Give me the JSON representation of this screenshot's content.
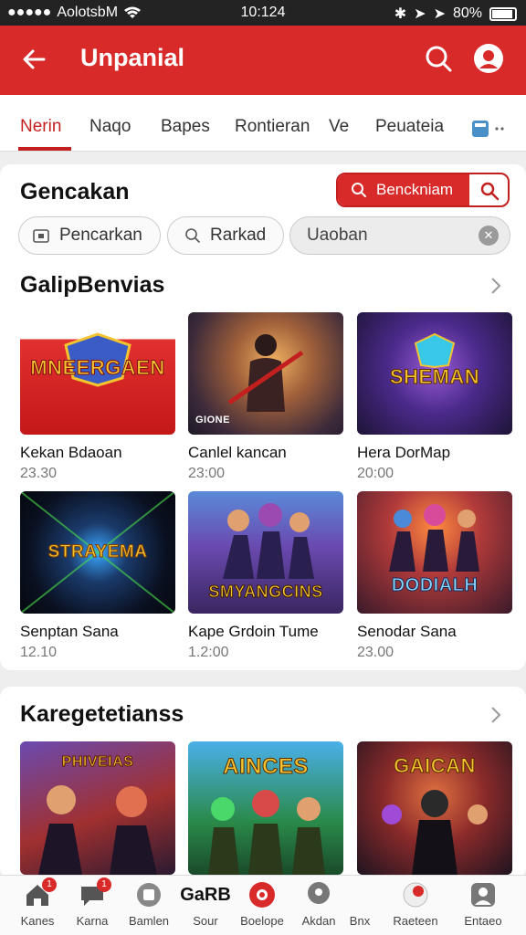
{
  "status_bar": {
    "carrier": "AolotsbM",
    "time": "10:124",
    "battery": "80%"
  },
  "app_bar": {
    "title": "Unpanial"
  },
  "tabs": [
    {
      "label": "Nerin",
      "active": true
    },
    {
      "label": "Naqo"
    },
    {
      "label": "Bapes"
    },
    {
      "label": "Rontieran"
    },
    {
      "label": "Ve"
    },
    {
      "label": "Peuateia"
    }
  ],
  "search_section": {
    "title": "Gencakan",
    "search_button": "Benckniam",
    "chips": [
      "Pencarkan",
      "Rarkad"
    ],
    "search_field": {
      "value": "Uaoban"
    }
  },
  "section1": {
    "title": "GalipBenvias",
    "games": [
      {
        "name": "Kekan Bdaoan",
        "price": "23.30",
        "logo": "MNEERGAEN"
      },
      {
        "name": "Canlel kancan",
        "price": "23:00",
        "logo": "GIONE"
      },
      {
        "name": "Hera DorMap",
        "price": "20:00",
        "logo": "SHEMAN"
      },
      {
        "name": "Senptan Sana",
        "price": "12.10",
        "logo": "STRAYEMA"
      },
      {
        "name": "Kape Grdoin Tume",
        "price": "1.2:00",
        "logo": "SMYANGCINS"
      },
      {
        "name": "Senodar Sana",
        "price": "23.00",
        "logo": "DODIALH"
      }
    ]
  },
  "section2": {
    "title": "Karegetetianss",
    "games": [
      {
        "logo": "PHIVEIAS"
      },
      {
        "logo": "AINCES"
      },
      {
        "logo": "GAICAN"
      }
    ],
    "overlay_text": "GaRB"
  },
  "bottom_nav": [
    {
      "label": "Kanes",
      "icon": "home-icon",
      "badge": "1"
    },
    {
      "label": "Karna",
      "icon": "chat-icon",
      "badge": "1"
    },
    {
      "label": "Bamlen",
      "icon": "store-icon"
    },
    {
      "label": "Sour",
      "icon": "text-logo-icon"
    },
    {
      "label": "Boelope",
      "icon": "game-icon"
    },
    {
      "label": "Akdan",
      "icon": "location-icon"
    },
    {
      "label": "Bnx",
      "icon": "none"
    },
    {
      "label": "Raeteen",
      "icon": "notify-icon"
    },
    {
      "label": "Entaeo",
      "icon": "profile-icon"
    }
  ],
  "colors": {
    "primary": "#d92a2a",
    "accent_text": "#c41f1f"
  }
}
